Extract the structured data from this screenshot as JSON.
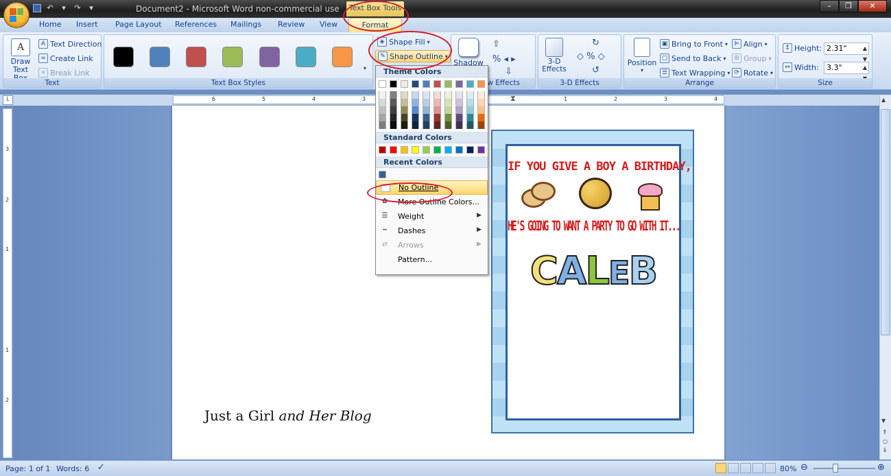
{
  "window": {
    "title": "Document2 - Microsoft Word non-commercial use",
    "contextual_tab": "Text Box Tools",
    "minimize_glyph": "–",
    "restore_glyph": "❐",
    "close_glyph": "✕",
    "help_glyph": "?"
  },
  "qat": {
    "save": "save-icon",
    "undo": "↶",
    "redo": "↷",
    "customize": "▾"
  },
  "tabs": [
    "Home",
    "Insert",
    "Page Layout",
    "References",
    "Mailings",
    "Review",
    "View",
    "Format"
  ],
  "ribbon": {
    "text_group": {
      "draw_text_box": "Draw\nText Box",
      "text_direction": "Text Direction",
      "create_link": "Create Link",
      "break_link": "Break Link",
      "label": "Text"
    },
    "styles_group": {
      "label": "Text Box Styles",
      "swatches": [
        "#000000",
        "#4f81bd",
        "#c0504d",
        "#9bbb59",
        "#8064a2",
        "#4bacc6",
        "#f79646"
      ]
    },
    "shape_fill": "Shape Fill",
    "shape_outline": "Shape Outline",
    "shadow": "Shadow",
    "shadow_effects_label": "w Effects",
    "threed": {
      "button": "3-D\nEffects",
      "label": "3-D Effects"
    },
    "arrange": {
      "position": "Position",
      "bring_to_front": "Bring to Front",
      "send_to_back": "Send to Back",
      "text_wrapping": "Text Wrapping",
      "align": "Align",
      "group": "Group",
      "rotate": "Rotate",
      "label": "Arrange"
    },
    "size": {
      "height_label": "Height:",
      "height_value": "2.31\"",
      "width_label": "Width:",
      "width_value": "3.3\"",
      "label": "Size"
    }
  },
  "ruler": {
    "left_numbers": [
      "6",
      "5",
      "4",
      "3"
    ],
    "right_numbers": [
      "1",
      "2",
      "3",
      "4"
    ],
    "vertical_numbers": [
      "3",
      "2",
      "1",
      "1",
      "2"
    ]
  },
  "dropdown": {
    "theme_colors": "Theme Colors",
    "standard_colors": "Standard Colors",
    "recent_colors": "Recent Colors",
    "theme_top_row": [
      "#ffffff",
      "#000000",
      "#eeece1",
      "#1f497d",
      "#4f81bd",
      "#c0504d",
      "#9bbb59",
      "#8064a2",
      "#4bacc6",
      "#f79646"
    ],
    "theme_shades": [
      [
        "#f2f2f2",
        "#7f7f7f",
        "#ddd9c3",
        "#c6d9f0",
        "#dbe5f1",
        "#f2dcdb",
        "#ebf1dd",
        "#e5e0ec",
        "#dbeef3",
        "#fdeada"
      ],
      [
        "#d8d8d8",
        "#595959",
        "#c4bd97",
        "#8db3e2",
        "#b8cce4",
        "#e5b9b7",
        "#d7e3bc",
        "#ccc1d9",
        "#b7dde8",
        "#fbd5b5"
      ],
      [
        "#bfbfbf",
        "#3f3f3f",
        "#938953",
        "#548dd4",
        "#95b3d7",
        "#d99694",
        "#c3d69b",
        "#b2a2c7",
        "#92cddc",
        "#fac08f"
      ],
      [
        "#a5a5a5",
        "#262626",
        "#494429",
        "#17365d",
        "#366092",
        "#953734",
        "#76923c",
        "#5f497a",
        "#31859b",
        "#e36c09"
      ],
      [
        "#7f7f7f",
        "#0c0c0c",
        "#1d1b10",
        "#0f243e",
        "#244061",
        "#632423",
        "#4f6128",
        "#3f3151",
        "#205867",
        "#974806"
      ]
    ],
    "standard": [
      "#c00000",
      "#ff0000",
      "#ffc000",
      "#ffff00",
      "#92d050",
      "#00b050",
      "#00b0f0",
      "#0070c0",
      "#002060",
      "#7030a0"
    ],
    "recent": [
      "#366092"
    ],
    "no_outline": "No Outline",
    "more_colors": "More Outline Colors...",
    "weight": "Weight",
    "dashes": "Dashes",
    "arrows": "Arrows",
    "pattern": "Pattern..."
  },
  "document": {
    "card_line1": "IF YOU GIVE A BOY A BIRTHDAY,",
    "card_line2": "HE'S GOING TO WANT A PARTY TO GO WITH IT...",
    "card_name_letters": [
      "C",
      "A",
      "L",
      "E",
      "B"
    ],
    "card_name_colors": [
      "#f4e07a",
      "#7fb0e8",
      "#8dc63f",
      "#7fb0e8",
      "#a9d1f2"
    ],
    "blog_plain": "Just a Girl",
    "blog_italic": "and Her Blog"
  },
  "status": {
    "page": "Page: 1 of 1",
    "words": "Words: 6",
    "zoom": "80%"
  }
}
